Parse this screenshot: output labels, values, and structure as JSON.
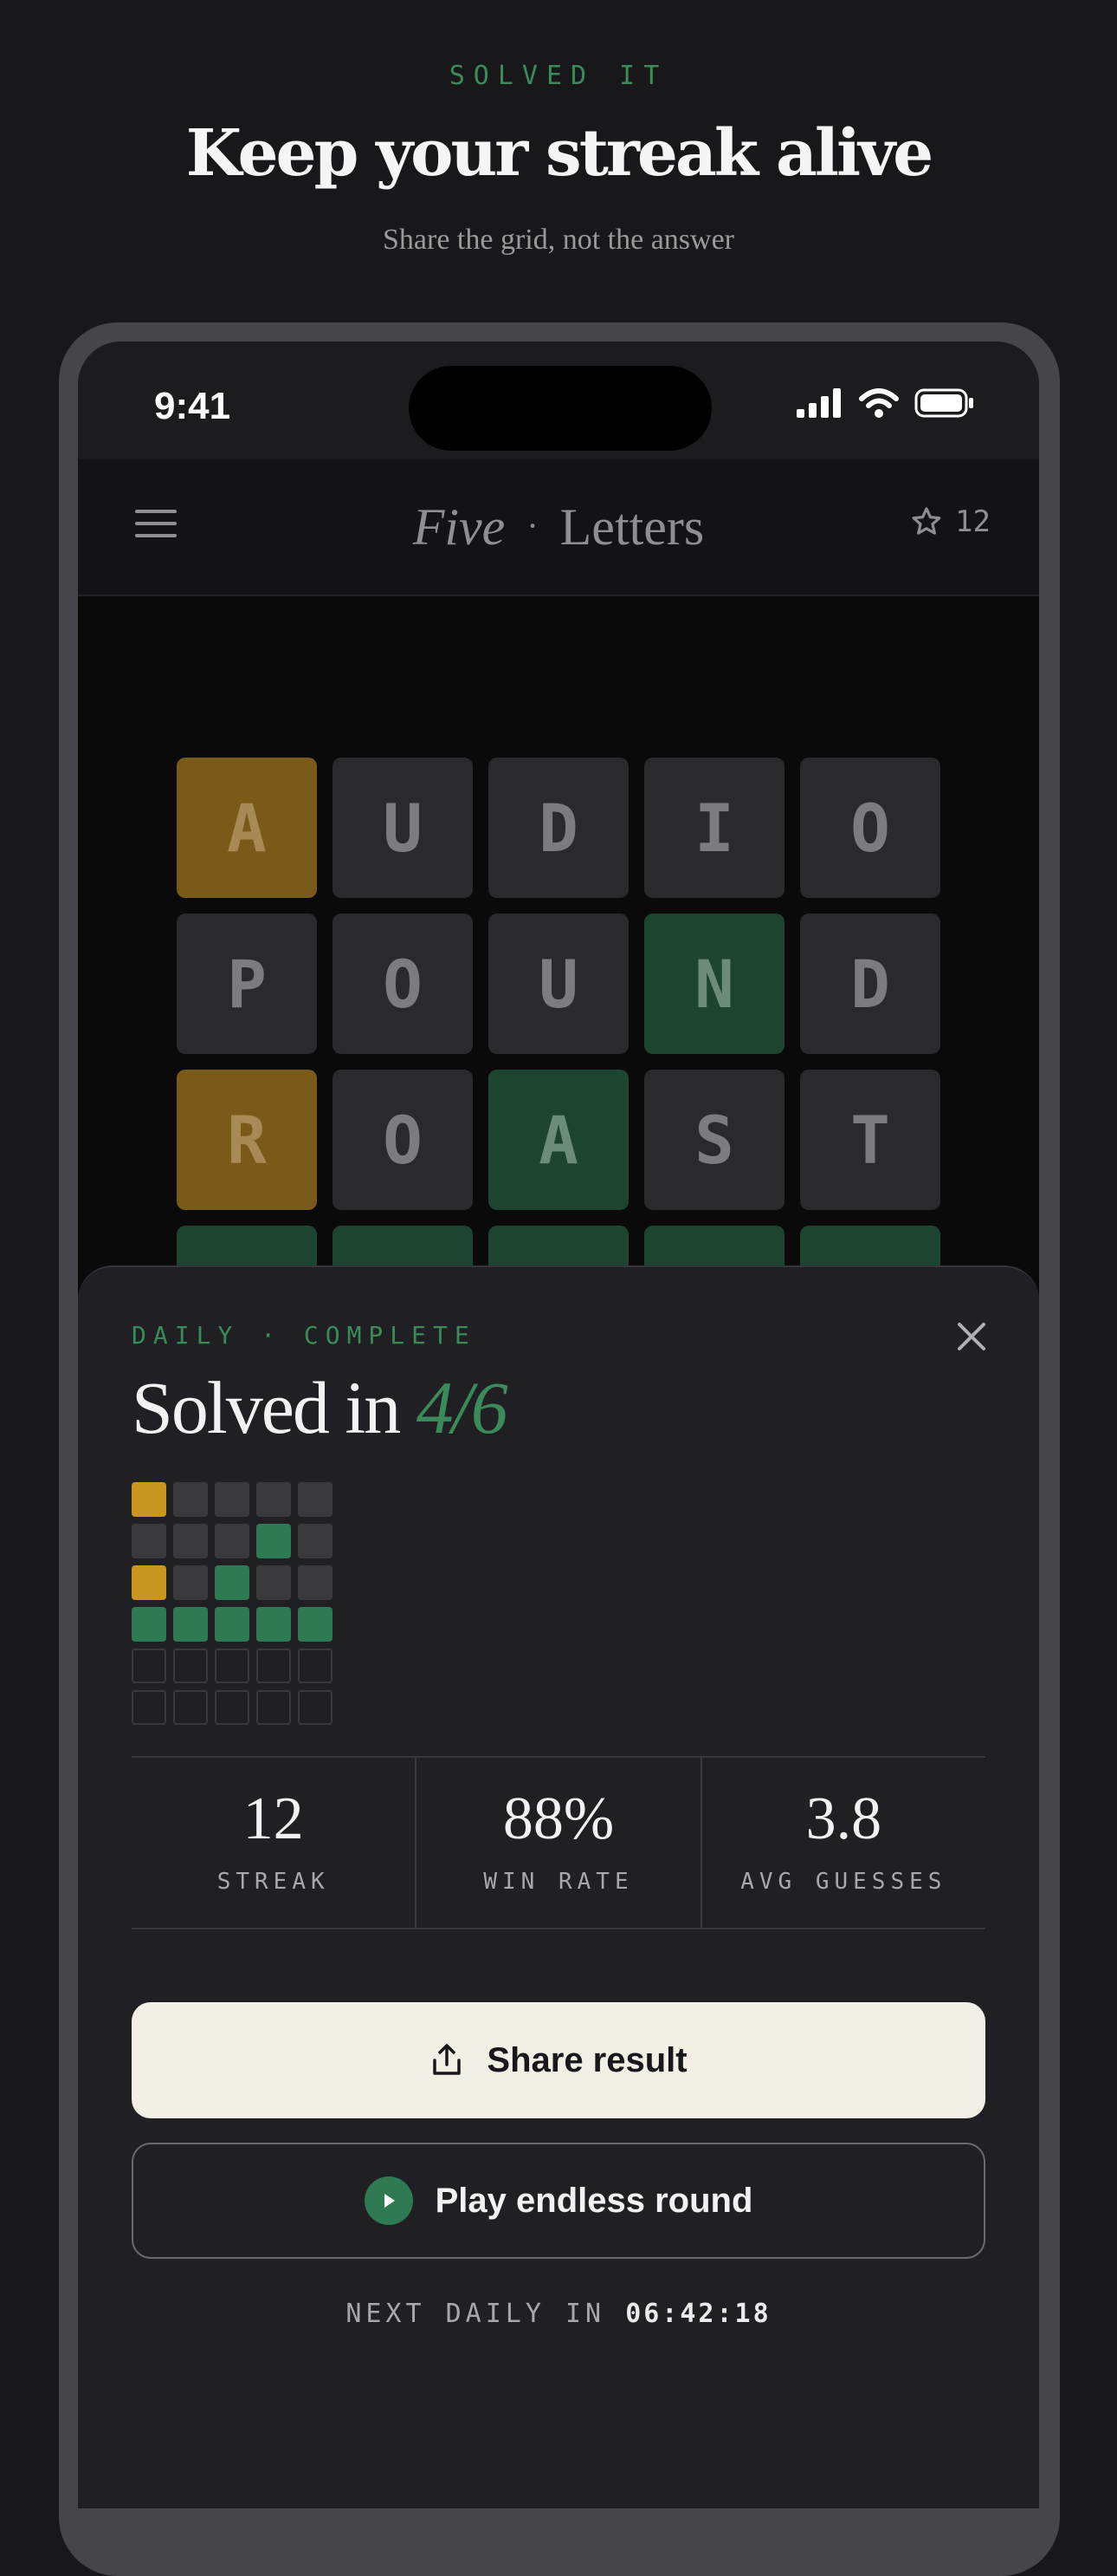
{
  "promo": {
    "eyebrow": "SOLVED IT",
    "headline": "Keep your streak alive",
    "subline": "Share the grid, not the answer"
  },
  "status_bar": {
    "time": "9:41"
  },
  "header": {
    "title_part1": "Five",
    "title_separator": "·",
    "title_part2": "Letters",
    "star_count": "12",
    "menu_icon": "hamburger-menu-icon",
    "star_icon": "star-icon"
  },
  "board": {
    "rows": [
      [
        {
          "letter": "A",
          "state": "present"
        },
        {
          "letter": "U",
          "state": "absent"
        },
        {
          "letter": "D",
          "state": "absent"
        },
        {
          "letter": "I",
          "state": "absent"
        },
        {
          "letter": "O",
          "state": "absent"
        }
      ],
      [
        {
          "letter": "P",
          "state": "absent"
        },
        {
          "letter": "O",
          "state": "absent"
        },
        {
          "letter": "U",
          "state": "absent"
        },
        {
          "letter": "N",
          "state": "correct"
        },
        {
          "letter": "D",
          "state": "absent"
        }
      ],
      [
        {
          "letter": "R",
          "state": "present"
        },
        {
          "letter": "O",
          "state": "absent"
        },
        {
          "letter": "A",
          "state": "correct"
        },
        {
          "letter": "S",
          "state": "absent"
        },
        {
          "letter": "T",
          "state": "absent"
        }
      ],
      [
        {
          "letter": "",
          "state": "correct"
        },
        {
          "letter": "",
          "state": "correct"
        },
        {
          "letter": "",
          "state": "correct"
        },
        {
          "letter": "",
          "state": "correct"
        },
        {
          "letter": "",
          "state": "correct"
        }
      ]
    ]
  },
  "sheet": {
    "eyebrow": "DAILY · COMPLETE",
    "title_prefix": "Solved in ",
    "title_score": "4/6",
    "mini_grid": [
      [
        "present",
        "absent",
        "absent",
        "absent",
        "absent"
      ],
      [
        "absent",
        "absent",
        "absent",
        "correct",
        "absent"
      ],
      [
        "present",
        "absent",
        "correct",
        "absent",
        "absent"
      ],
      [
        "correct",
        "correct",
        "correct",
        "correct",
        "correct"
      ],
      [
        "empty",
        "empty",
        "empty",
        "empty",
        "empty"
      ],
      [
        "empty",
        "empty",
        "empty",
        "empty",
        "empty"
      ]
    ],
    "stats": [
      {
        "value": "12",
        "label": "STREAK"
      },
      {
        "value": "88%",
        "label": "WIN RATE"
      },
      {
        "value": "3.8",
        "label": "AVG GUESSES"
      }
    ],
    "share_label": "Share result",
    "endless_label": "Play endless round",
    "next_daily_prefix": "NEXT DAILY IN ",
    "next_daily_countdown": "06:42:18"
  },
  "colors": {
    "accent_green": "#3a8a5a",
    "present_yellow": "#c99622",
    "correct_green": "#2f7a52"
  }
}
